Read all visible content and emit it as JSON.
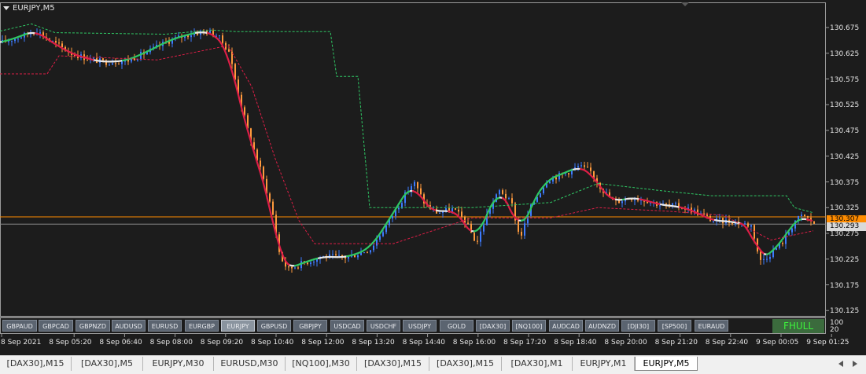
{
  "chart": {
    "title": "EURJPY,M5",
    "current_price": "130.307",
    "secondary_price": "130.293",
    "colors": {
      "background": "#1c1c1c",
      "candle_up": "#3d7bff",
      "candle_down": "#ff9a3d",
      "ma_red": "#dc1e46",
      "ma_white": "#e8e8e8",
      "ma_green": "#2fc764",
      "upper_band": "#2fc764",
      "lower_band": "#dc1e46",
      "price_line": "#ff8c00"
    }
  },
  "price_axis": [
    "130.675",
    "130.625",
    "130.575",
    "130.525",
    "130.475",
    "130.425",
    "130.375",
    "130.325",
    "130.275",
    "130.225",
    "130.175",
    "130.125"
  ],
  "sub_axis": [
    "100",
    "20"
  ],
  "time_axis": [
    "8 Sep 2021",
    "8 Sep 05:20",
    "8 Sep 06:40",
    "8 Sep 08:00",
    "8 Sep 09:20",
    "8 Sep 10:40",
    "8 Sep 12:00",
    "8 Sep 13:20",
    "8 Sep 14:40",
    "8 Sep 16:00",
    "8 Sep 17:20",
    "8 Sep 18:40",
    "8 Sep 20:00",
    "8 Sep 21:20",
    "8 Sep 22:40",
    "9 Sep 00:05",
    "9 Sep 01:25"
  ],
  "symbol_buttons": [
    "GBPAUD",
    "GBPCAD",
    "GBPNZD",
    "AUDUSD",
    "EURUSD",
    "EURGBP",
    "EURJPY",
    "GBPUSD",
    "GBPJPY",
    "USDCAD",
    "USDCHF",
    "USDJPY",
    "GOLD",
    "[DAX30]",
    "[NQ100]",
    "AUDCAD",
    "AUDNZD",
    "[DJI30]",
    "[SP500]",
    "EURAUD"
  ],
  "active_symbol": "EURJPY",
  "fhull_label": "FHULL",
  "tabs": [
    "[DAX30],M15",
    "[DAX30],M5",
    "EURJPY,M30",
    "EURUSD,M30",
    "[NQ100],M30",
    "[DAX30],M15",
    "[DAX30],M15",
    "[DAX30],M1",
    "EURJPY,M1",
    "EURJPY,M5"
  ],
  "active_tab": 9
}
